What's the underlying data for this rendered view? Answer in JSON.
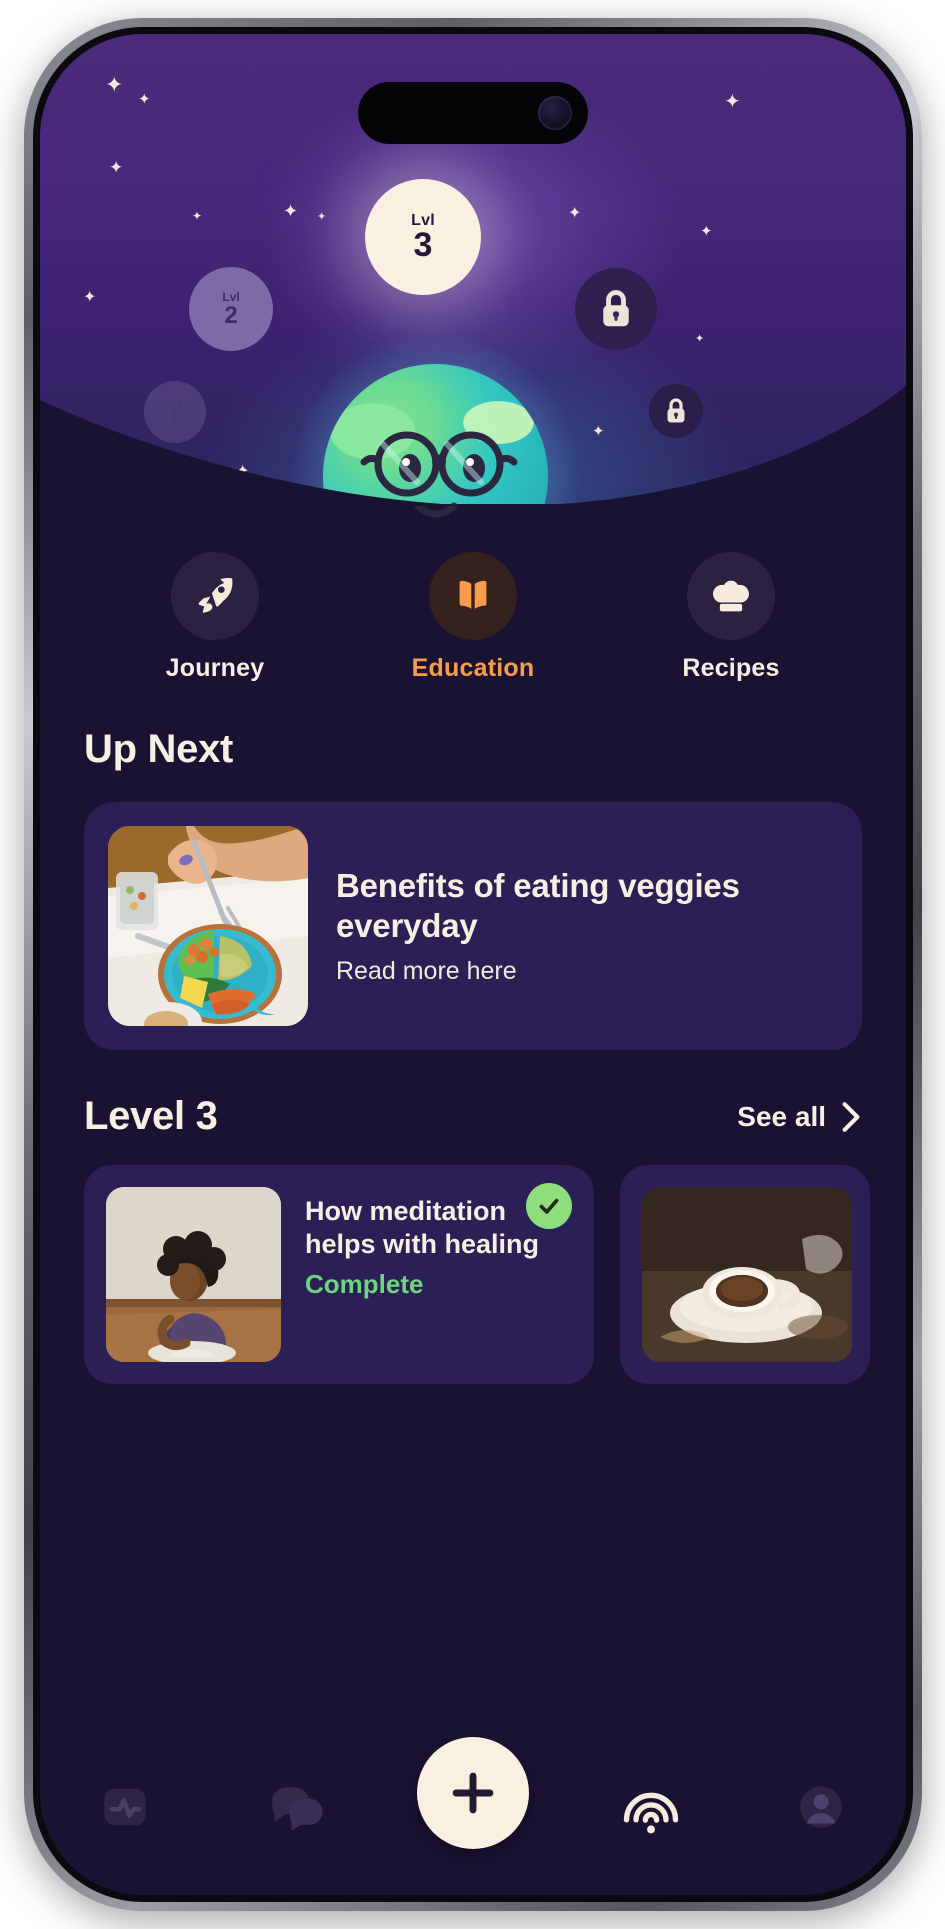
{
  "app": {
    "accent_orange": "#f79c4a",
    "cream": "#f8efe3",
    "card_purple": "#2b1f55",
    "bg_dark": "#1a1233",
    "green": "#8ede7c"
  },
  "hero": {
    "levels": [
      {
        "id": "lvl-3",
        "label": "Lvl",
        "value": "3",
        "state": "current"
      },
      {
        "id": "lvl-2",
        "label": "Lvl",
        "value": "2",
        "state": "completed"
      },
      {
        "id": "lvl-1",
        "label": "Lvl",
        "value": "1",
        "state": "completed-faded"
      }
    ],
    "locked": [
      {
        "id": "lock-large",
        "icon": "lock-icon"
      },
      {
        "id": "lock-small",
        "icon": "lock-icon"
      }
    ],
    "mascot": {
      "name": "earth-mascot",
      "icon": "earth-with-glasses-icon"
    }
  },
  "tabs": [
    {
      "key": "journey",
      "label": "Journey",
      "icon": "rocket-icon",
      "active": false
    },
    {
      "key": "education",
      "label": "Education",
      "icon": "book-icon",
      "active": true
    },
    {
      "key": "recipes",
      "label": "Recipes",
      "icon": "chef-hat-icon",
      "active": false
    }
  ],
  "up_next": {
    "heading": "Up Next",
    "card": {
      "title": "Benefits of eating veggies everyday",
      "subtitle": "Read more here",
      "image_alt": "person-eating-veggie-bowl"
    }
  },
  "level_section": {
    "heading": "Level 3",
    "see_all_label": "See all",
    "see_all_icon": "chevron-right-icon",
    "cards": [
      {
        "title": "How meditation helps with healing",
        "status": "Complete",
        "completed": true,
        "badge_icon": "check-circle-icon",
        "image_alt": "woman-meditating"
      },
      {
        "title": "",
        "status": "",
        "completed": false,
        "image_alt": "cup-of-coffee"
      }
    ]
  },
  "bottom_nav": [
    {
      "key": "activity",
      "icon": "pulse-icon",
      "active": false
    },
    {
      "key": "chat",
      "icon": "chat-icon",
      "active": false
    },
    {
      "key": "add",
      "icon": "plus-icon",
      "active": true
    },
    {
      "key": "sounds",
      "icon": "rainbow-icon",
      "active": false
    },
    {
      "key": "profile",
      "icon": "person-icon",
      "active": false
    }
  ]
}
